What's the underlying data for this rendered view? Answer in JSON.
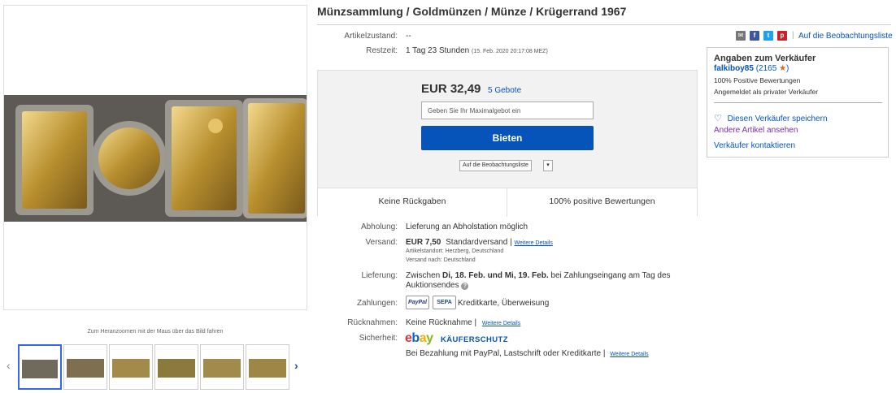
{
  "image_panel": {
    "zoom_hint": "Zum Heranzoomen mit der Maus über das Bild fahren",
    "thumbnail_count": 6
  },
  "title": "Münzsammlung / Goldmünzen / Münze / Krügerrand 1967",
  "details": {
    "condition_label": "Artikelzustand:",
    "condition_value": "--",
    "remaining_label": "Restzeit:",
    "remaining_value": "1 Tag 23 Stunden",
    "remaining_date": "(15. Feb. 2020   20:17:08 MEZ)"
  },
  "share": {
    "icons": [
      "mail-icon",
      "facebook-icon",
      "twitter-icon",
      "pinterest-icon"
    ],
    "watch_link": "Auf die Beobachtungsliste"
  },
  "bid": {
    "price": "EUR 32,49",
    "bids_count": "5 Gebote",
    "max_bid_placeholder": "Geben Sie Ihr Maximalgebot ein",
    "bid_button": "Bieten",
    "watch_select": "Auf die Beobachtungsliste",
    "footer_left": "Keine Rückgaben",
    "footer_right": "100% positive Bewertungen"
  },
  "seller": {
    "title": "Angaben zum Verkäufer",
    "name": "falkiboy85",
    "score": "(2165",
    "score_close": ")",
    "positive": "100% Positive Bewertungen",
    "type": "Angemeldet als privater Verkäufer",
    "save": "Diesen Verkäufer speichern",
    "other_items": "Andere Artikel ansehen",
    "contact": "Verkäufer kontaktieren",
    "star_color": "#e0651d"
  },
  "shipping": {
    "pickup_label": "Abholung:",
    "pickup_value": "Lieferung an Abholstation möglich",
    "ship_label": "Versand:",
    "ship_price": "EUR 7,50",
    "ship_type": "Standardversand",
    "sep": "|",
    "details_link": "Weitere Details",
    "location": "Artikelstandort:  Herzberg, Deutschland",
    "ships_to": "Versand nach:  Deutschland",
    "delivery_label": "Lieferung:",
    "delivery_pre": "Zwischen",
    "delivery_dates": "Di, 18. Feb. und Mi, 19. Feb.",
    "delivery_post": "bei Zahlungseingang am Tag des",
    "delivery_line2": "Auktionsendes",
    "payment_label": "Zahlungen:",
    "paypal": "PayPal",
    "sepa": "SEPA",
    "payment_methods": "Kreditkarte, Überweisung",
    "returns_label": "Rücknahmen:",
    "returns_value": "Keine Rücknahme",
    "security_label": "Sicherheit:",
    "ebay": [
      "e",
      "b",
      "a",
      "y"
    ],
    "protection": "KÄUFERSCHUTZ",
    "protection_text": "Bei Bezahlung mit PayPal, Lastschrift oder Kreditkarte"
  }
}
